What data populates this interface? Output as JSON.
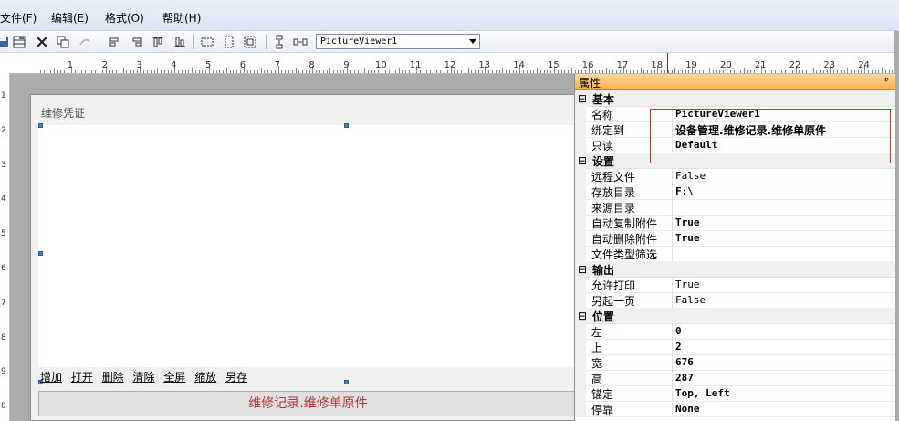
{
  "menu": [
    "文件(F)",
    "编辑(E)",
    "格式(O)",
    "帮助(H)"
  ],
  "toolbar": {
    "control_select": "PictureViewer1",
    "icons": [
      "save-icon",
      "grid-icon",
      "delete-icon",
      "copy-icon",
      "redo-icon",
      "align-left-icon",
      "align-right-icon",
      "align-top-icon",
      "align-bottom-icon",
      "same-width-icon",
      "same-height-icon",
      "same-size-icon",
      "vertical-space-icon",
      "horizontal-space-icon"
    ]
  },
  "ruler": {
    "numbers": [
      "1",
      "2",
      "3",
      "4",
      "5",
      "6",
      "7",
      "8",
      "9",
      "10",
      "11",
      "12",
      "13",
      "14",
      "15",
      "16",
      "17",
      "18",
      "19",
      "20",
      "21",
      "22",
      "23",
      "24"
    ],
    "vnumbers": [
      "1",
      "2",
      "3",
      "4",
      "5",
      "6",
      "7",
      "8",
      "9",
      "0"
    ]
  },
  "form": {
    "title": "维修凭证",
    "links": [
      "增加",
      "打开",
      "删除",
      "清除",
      "全屏",
      "缩放",
      "另存"
    ],
    "bind_label": "维修记录.维修单原件"
  },
  "properties": {
    "title": "属性",
    "pin": "ꟼ",
    "categories": [
      {
        "name": "基本",
        "rows": [
          {
            "name": "名称",
            "value": "PictureViewer1",
            "bold": true
          },
          {
            "name": "绑定到",
            "value": "设备管理.维修记录.维修单原件",
            "bold": true,
            "cn": true
          },
          {
            "name": "只读",
            "value": "Default",
            "bold": true
          }
        ]
      },
      {
        "name": "设置",
        "rows": [
          {
            "name": "远程文件",
            "value": "False",
            "bold": false
          },
          {
            "name": "存放目录",
            "value": "F:\\",
            "bold": true
          },
          {
            "name": "来源目录",
            "value": "",
            "bold": false
          },
          {
            "name": "自动复制附件",
            "value": "True",
            "bold": true
          },
          {
            "name": "自动删除附件",
            "value": "True",
            "bold": true
          },
          {
            "name": "文件类型筛选",
            "value": "",
            "bold": false
          }
        ]
      },
      {
        "name": "输出",
        "rows": [
          {
            "name": "允许打印",
            "value": "True",
            "bold": false
          },
          {
            "name": "另起一页",
            "value": "False",
            "bold": false
          }
        ]
      },
      {
        "name": "位置",
        "rows": [
          {
            "name": "左",
            "value": "0",
            "bold": true
          },
          {
            "name": "上",
            "value": "2",
            "bold": true
          },
          {
            "name": "宽",
            "value": "676",
            "bold": true
          },
          {
            "name": "高",
            "value": "287",
            "bold": true
          },
          {
            "name": "锚定",
            "value": "Top, Left",
            "bold": true
          },
          {
            "name": "停靠",
            "value": "None",
            "bold": true
          }
        ]
      }
    ]
  }
}
